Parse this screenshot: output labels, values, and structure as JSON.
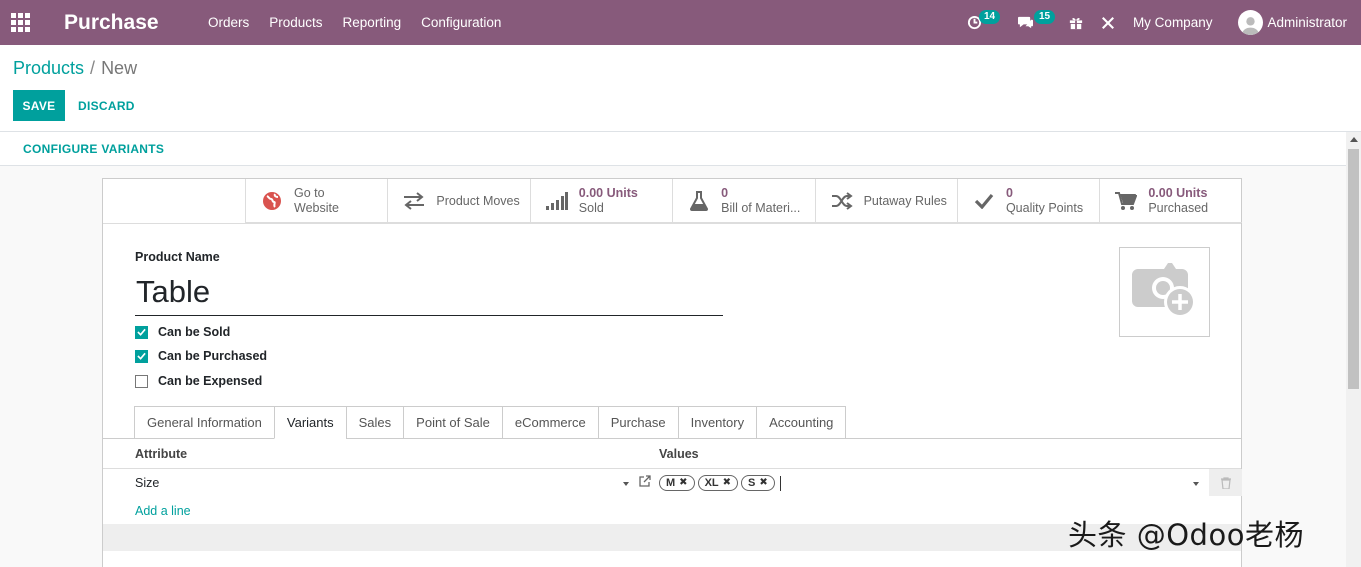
{
  "navbar": {
    "app_title": "Purchase",
    "menu": [
      "Orders",
      "Products",
      "Reporting",
      "Configuration"
    ],
    "activity_count": "14",
    "messages_count": "15",
    "company": "My Company",
    "user": "Administrator"
  },
  "breadcrumb": {
    "parent": "Products",
    "separator": "/",
    "current": "New"
  },
  "actions": {
    "save": "SAVE",
    "discard": "DISCARD",
    "configure_variants": "CONFIGURE VARIANTS"
  },
  "smart_buttons": {
    "website": {
      "line1": "Go to",
      "line2": "Website",
      "icon": "globe-icon"
    },
    "moves": {
      "label": "Product Moves",
      "icon": "exchange-arrows-icon"
    },
    "sold": {
      "value": "0.00 Units",
      "label": "Sold",
      "icon": "signal-bars-icon"
    },
    "bom": {
      "value": "0",
      "label": "Bill of Materi...",
      "icon": "flask-icon"
    },
    "putaway": {
      "label": "Putaway Rules",
      "icon": "shuffle-icon"
    },
    "quality": {
      "value": "0",
      "label": "Quality Points",
      "icon": "check-icon"
    },
    "purchased": {
      "value": "0.00 Units",
      "label": "Purchased",
      "icon": "cart-icon"
    }
  },
  "form": {
    "name_label": "Product Name",
    "name_value": "Table",
    "can_be_sold": {
      "label": "Can be Sold",
      "checked": true
    },
    "can_be_purchased": {
      "label": "Can be Purchased",
      "checked": true
    },
    "can_be_expensed": {
      "label": "Can be Expensed",
      "checked": false
    }
  },
  "tabs": [
    "General Information",
    "Variants",
    "Sales",
    "Point of Sale",
    "eCommerce",
    "Purchase",
    "Inventory",
    "Accounting"
  ],
  "active_tab": "Variants",
  "variants_table": {
    "col_attribute": "Attribute",
    "col_values": "Values",
    "rows": [
      {
        "attribute": "Size",
        "values": [
          "M",
          "XL",
          "S"
        ]
      }
    ],
    "add_line": "Add a line"
  },
  "watermark": "头条 @Odoo老杨",
  "colors": {
    "navbar": "#875a7b",
    "accent": "#00a09d"
  }
}
